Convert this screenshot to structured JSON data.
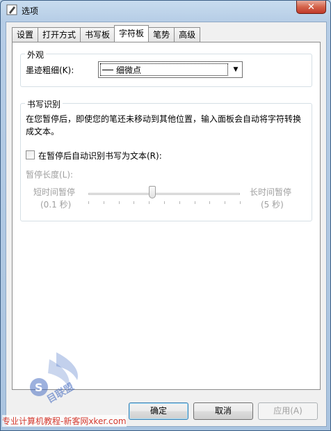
{
  "window": {
    "title": "选项",
    "close_glyph": "✕"
  },
  "tabs": [
    {
      "label": "设置"
    },
    {
      "label": "打开方式"
    },
    {
      "label": "书写板"
    },
    {
      "label": "字符板"
    },
    {
      "label": "笔势"
    },
    {
      "label": "高级"
    }
  ],
  "active_tab": "字符板",
  "appearance": {
    "group_title": "外观",
    "ink_label": "墨迹粗细(K):",
    "ink_value": "细微点"
  },
  "handwriting": {
    "group_title": "书写识别",
    "description": "在您暂停后，即使您的笔还未移动到其他位置，输入面板会自动将字符转换成文本。",
    "auto_recognize_label": "在暂停后自动识别书写为文本(R):",
    "auto_recognize_checked": false,
    "pause_length_label": "暂停长度(L):",
    "short_label": "短时间暂停",
    "short_value": "(0.1 秒)",
    "long_label": "长时间暂停",
    "long_value": "(5 秒)",
    "slider_fraction": 0.42
  },
  "buttons": {
    "ok": "确定",
    "cancel": "取消",
    "apply": "应用(A)"
  },
  "watermark": {
    "text": "专业计算机教程-新客网xker.com",
    "logo_text": "S 目联盟"
  },
  "colors": {
    "accent": "#3c7fb1",
    "watermark": "#d43a2f"
  }
}
